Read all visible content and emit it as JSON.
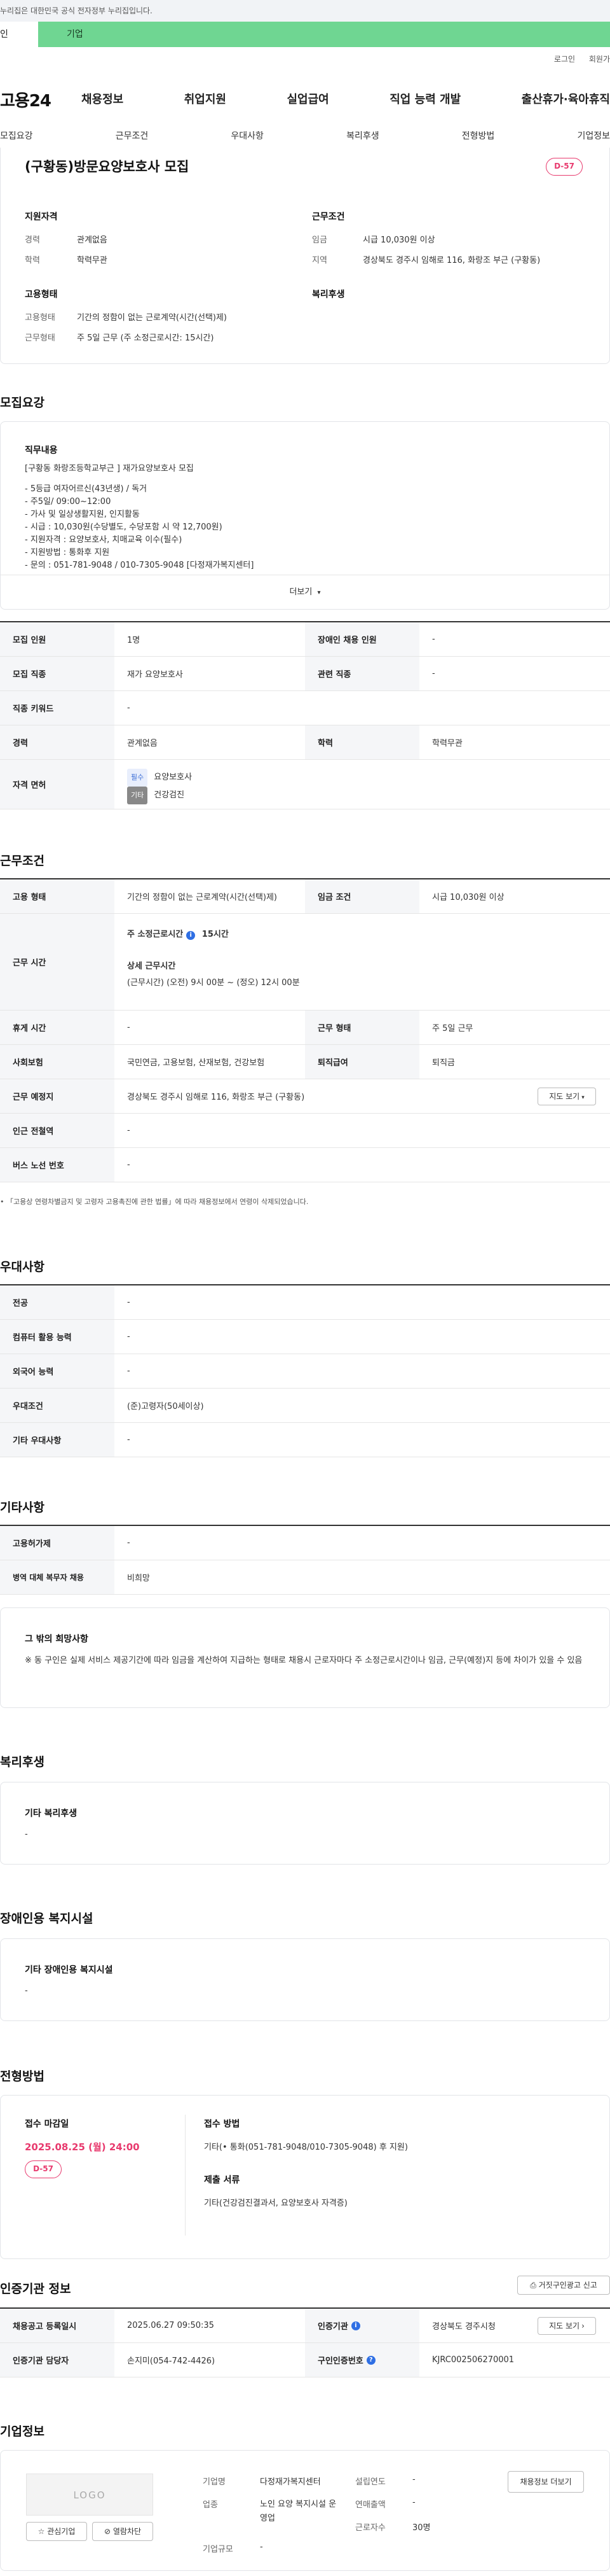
{
  "top_notice": "누리집은 대한민국 공식 전자정부 누리집입니다.",
  "gov_tabs": {
    "individual": "인",
    "enterprise": "기업"
  },
  "util_links": [
    "로그인",
    "회원가"
  ],
  "logo": "고용24",
  "gnb": [
    "채용정보",
    "취업지원",
    "실업급여",
    "직업 능력 개발",
    "출산휴가·육아휴직"
  ],
  "tabs": [
    "모집요강",
    "근무조건",
    "우대사항",
    "복리후생",
    "전형방법",
    "기업정보"
  ],
  "summary": {
    "title": "(구황동)방문요양보호사 모집",
    "dday": "D-57",
    "qual_heading": "지원자격",
    "career_label": "경력",
    "career_value": "관계없음",
    "edu_label": "학력",
    "edu_value": "학력무관",
    "form_heading": "고용형태",
    "emptype_label": "고용형태",
    "emptype_value": "기간의 정함이 없는 근로계약(시간(선택)제)",
    "worktype_label": "근무형태",
    "worktype_value": "주 5일 근무 (주 소정근로시간: 15시간)",
    "cond_heading": "근무조건",
    "wage_label": "임금",
    "wage_value": "시급 10,030원 이상",
    "region_label": "지역",
    "region_value": "경상북도 경주시 임해로 116, 화랑조 부근 (구황동)",
    "welfare_heading": "복리후생"
  },
  "recruit": {
    "heading": "모집요강",
    "duty_heading": "직무내용",
    "duty_lines": [
      "[구황동 화랑조등학교부근 ] 재가요양보호사 모집",
      "",
      "- 5등급 여자어르신(43년생) / 독거",
      "- 주5일/ 09:00~12:00",
      "- 가사 및 일상생활지원, 인지활동",
      "- 시급 : 10,030원(수당별도, 수당포함 시 약 12,700원)",
      "- 지원자격 : 요양보호사, 치매교육 이수(필수)",
      "- 지원방법 : 통화후 지원",
      "- 문의 : 051-781-9048 / 010-7305-9048 [다정재가복지센터]"
    ],
    "more": "더보기",
    "rows": {
      "count_label": "모집 인원",
      "count_value": "1명",
      "disabled_label": "장애인 채용 인원",
      "disabled_value": "-",
      "job_label": "모집 직종",
      "job_value": "재가 요양보호사",
      "related_label": "관련 직종",
      "related_value": "-",
      "keyword_label": "직종 키워드",
      "keyword_value": "-",
      "career_label": "경력",
      "career_value": "관계없음",
      "edu_label": "학력",
      "edu_value": "학력무관",
      "license_label": "자격 면허",
      "license_items": [
        {
          "chip": "필수",
          "chip_color": "#e8eefc",
          "chip_text": "#3d6fd6",
          "name": "요양보호사"
        },
        {
          "chip": "기타",
          "chip_color": "#888888",
          "chip_text": "#ffffff",
          "name": "건강검진"
        }
      ]
    }
  },
  "work": {
    "heading": "근무조건",
    "emptype_label": "고용 형태",
    "emptype_value": "기간의 정함이 없는 근로계약(시간(선택)제)",
    "wage_label": "임금 조건",
    "wage_value": "시급 10,030원 이상",
    "hours_label": "근무 시간",
    "weekly_hours": "주 소정근로시간",
    "weekly_hours_value": "15시간",
    "detail_heading": "상세 근무시간",
    "detail_value": "(근무시간) (오전) 9시 00분 ~ (정오) 12시 00분",
    "rest_label": "휴게 시간",
    "rest_value": "-",
    "form_label": "근무 형태",
    "form_value": "주 5일 근무",
    "insurance_label": "사회보험",
    "insurance_value": "국민연금, 고용보험, 산재보험, 건강보험",
    "retire_label": "퇴직급여",
    "retire_value": "퇴직금",
    "place_label": "근무 예정지",
    "place_value": "경상북도 경주시 임해로 116, 화랑조 부근 (구황동)",
    "map_btn": "지도 보기",
    "station_label": "인근 전철역",
    "station_value": "-",
    "bus_label": "버스 노선 번호",
    "bus_value": "-",
    "note": "「고용상 연령차별금지 및 고령자 고용촉진에 관한 법률」에 따라 채용정보에서 연령이 삭제되었습니다."
  },
  "pref": {
    "heading": "우대사항",
    "major_label": "전공",
    "major_value": "-",
    "computer_label": "컴퓨터 활용 능력",
    "computer_value": "-",
    "lang_label": "외국어 능력",
    "lang_value": "-",
    "cond_label": "우대조건",
    "cond_value": "(준)고령자(50세이상)",
    "etc_label": "기타 우대사항",
    "etc_value": "-"
  },
  "other": {
    "heading": "기타사항",
    "agency_label": "고용허가제",
    "agency_value": "-",
    "military_label": "병역 대체 복무자 채용",
    "military_value": "비희망",
    "wish_heading": "그 밖의 희망사항",
    "wish_text": "※ 동 구인은 실제 서비스 제공기간에 따라 임금을 계산하여 지급하는 형태로 채용시 근로자마다 주 소정근로시간이나 임금, 근무(예정)지 등에 차이가 있을 수 있음"
  },
  "welfare": {
    "heading": "복리후생",
    "sub": "기타 복리후생",
    "value": "-"
  },
  "disabled_fac": {
    "heading": "장애인용 복지시설",
    "sub": "기타 장애인용 복지시설",
    "value": "-"
  },
  "selection": {
    "heading": "전형방법",
    "deadline_label": "접수 마감일",
    "deadline_value": "2025.08.25 (월) 24:00",
    "dday": "D-57",
    "method_label": "접수 방법",
    "method_value": "기타(• 통화(051-781-9048/010-7305-9048) 후 지원)",
    "docs_label": "제출 서류",
    "docs_value": "기타(건강검진결과서, 요양보호사 자격증)"
  },
  "cert": {
    "heading": "인증기관 정보",
    "report_btn": "거짓구인광고 신고",
    "reg_label": "채용공고 등록일시",
    "reg_value": "2025.06.27 09:50:35",
    "org_label": "인증기관",
    "org_value": "경상북도 경주시청",
    "map_btn": "지도 보기",
    "manager_label": "인증기관 담당자",
    "manager_value": "손지미(054-742-4426)",
    "cert_no_label": "구인인증번호",
    "cert_no_value": "KJRC002506270001"
  },
  "company": {
    "heading": "기업정보",
    "logo_text": "LOGO",
    "fav_btn": "관심기업",
    "block_btn": "열람차단",
    "name_label": "기업명",
    "name_value": "다정재가복지센터",
    "industry_label": "업종",
    "industry_value": "노인 요양 복지시설 운영업",
    "size_label": "기업규모",
    "size_value": "-",
    "founded_label": "설립연도",
    "founded_value": "-",
    "sales_label": "연매출액",
    "sales_value": "-",
    "employees_label": "근로자수",
    "employees_value": "30명",
    "jobs_btn": "채용정보 더보기"
  }
}
